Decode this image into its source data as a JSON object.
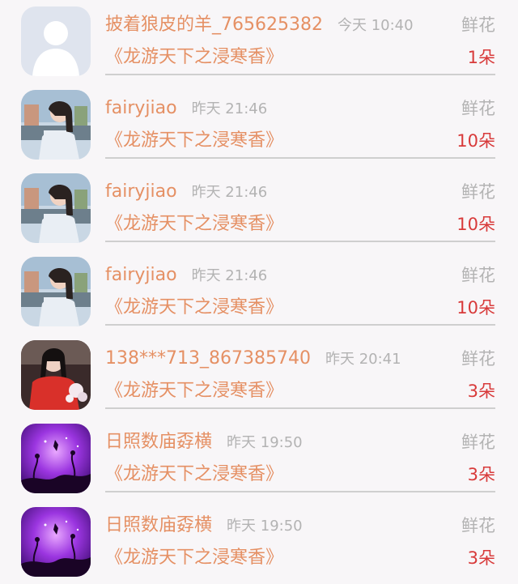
{
  "entries": [
    {
      "user": "披着狼皮的羊_765625382",
      "time": "今天 10:40",
      "gift": "鲜花",
      "book": "《龙游天下之浸寒香》",
      "count": "1朵",
      "avatar": "default"
    },
    {
      "user": "fairyjiao",
      "time": "昨天 21:46",
      "gift": "鲜花",
      "book": "《龙游天下之浸寒香》",
      "count": "10朵",
      "avatar": "photo-girl"
    },
    {
      "user": "fairyjiao",
      "time": "昨天 21:46",
      "gift": "鲜花",
      "book": "《龙游天下之浸寒香》",
      "count": "10朵",
      "avatar": "photo-girl"
    },
    {
      "user": "fairyjiao",
      "time": "昨天 21:46",
      "gift": "鲜花",
      "book": "《龙游天下之浸寒香》",
      "count": "10朵",
      "avatar": "photo-girl"
    },
    {
      "user": "138***713_867385740",
      "time": "昨天 20:41",
      "gift": "鲜花",
      "book": "《龙游天下之浸寒香》",
      "count": "3朵",
      "avatar": "photo-red"
    },
    {
      "user": "日照数庙孬横",
      "time": "昨天 19:50",
      "gift": "鲜花",
      "book": "《龙游天下之浸寒香》",
      "count": "3朵",
      "avatar": "purple-fairy"
    },
    {
      "user": "日照数庙孬横",
      "time": "昨天 19:50",
      "gift": "鲜花",
      "book": "《龙游天下之浸寒香》",
      "count": "3朵",
      "avatar": "purple-fairy"
    }
  ]
}
